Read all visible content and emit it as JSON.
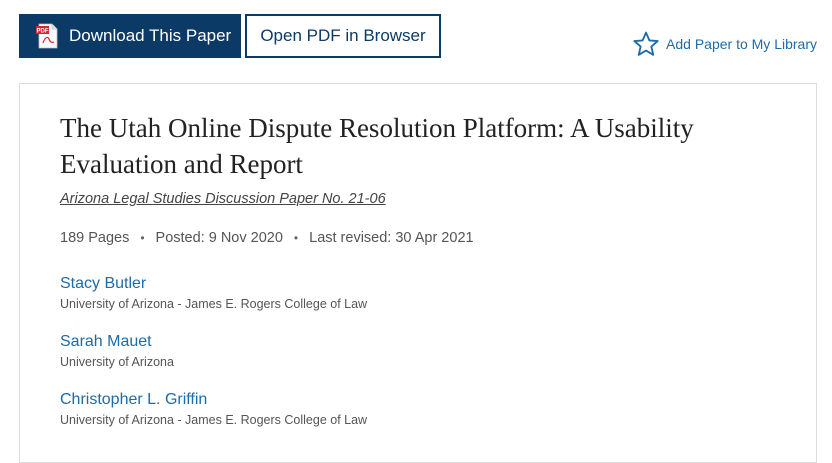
{
  "toolbar": {
    "download_label": "Download This Paper",
    "open_pdf_label": "Open PDF in Browser",
    "add_library_label": "Add Paper to My Library",
    "pdf_icon_text": "PDF",
    "download_icon": "pdf-file-icon",
    "library_icon": "star-outline-icon"
  },
  "paper": {
    "title": "The Utah Online Dispute Resolution Platform: A Usability Evaluation and Report",
    "series": "Arizona Legal Studies Discussion Paper No. 21-06",
    "pages": "189 Pages",
    "posted": "Posted: 9 Nov 2020",
    "last_revised": "Last revised: 30 Apr 2021"
  },
  "authors": [
    {
      "name": "Stacy Butler",
      "affiliation": "University of Arizona - James E. Rogers College of Law"
    },
    {
      "name": "Sarah Mauet",
      "affiliation": "University of Arizona"
    },
    {
      "name": "Christopher L. Griffin",
      "affiliation": "University of Arizona - James E. Rogers College of Law"
    }
  ],
  "colors": {
    "primary": "#0c3a66",
    "link": "#1d6ba8",
    "pdf_red": "#d7262b"
  }
}
